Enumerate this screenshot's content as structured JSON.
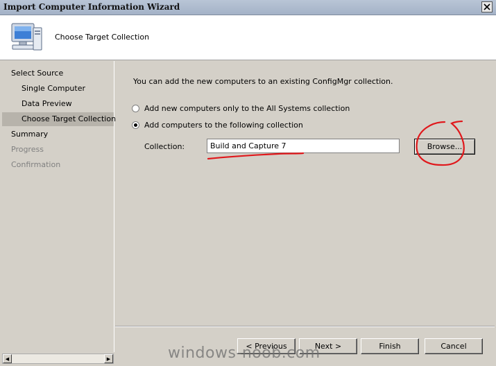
{
  "window": {
    "title": "Import Computer Information Wizard"
  },
  "header": {
    "title": "Choose Target Collection",
    "icon": "computer-icon"
  },
  "nav": {
    "items": [
      {
        "label": "Select Source",
        "indent": false,
        "state": "normal"
      },
      {
        "label": "Single Computer",
        "indent": true,
        "state": "normal"
      },
      {
        "label": "Data Preview",
        "indent": true,
        "state": "normal"
      },
      {
        "label": "Choose Target Collection",
        "indent": true,
        "state": "selected"
      },
      {
        "label": "Summary",
        "indent": false,
        "state": "normal"
      },
      {
        "label": "Progress",
        "indent": false,
        "state": "disabled"
      },
      {
        "label": "Confirmation",
        "indent": false,
        "state": "disabled"
      }
    ]
  },
  "main": {
    "intro": "You can add the new computers to an existing ConfigMgr collection.",
    "options": [
      {
        "label": "Add new computers only to the All Systems collection",
        "checked": false
      },
      {
        "label": "Add computers to the following collection",
        "checked": true
      }
    ],
    "collection_label": "Collection:",
    "collection_value": "Build and Capture 7",
    "browse_label": "Browse..."
  },
  "footer": {
    "previous_label": "< Previous",
    "next_label": "Next >",
    "finish_label": "Finish",
    "cancel_label": "Cancel"
  },
  "watermark": "windows-noob.com",
  "colors": {
    "annotation": "#e0181c",
    "selected_nav": "#b7b3ab",
    "dialog_bg": "#d4d0c8"
  }
}
